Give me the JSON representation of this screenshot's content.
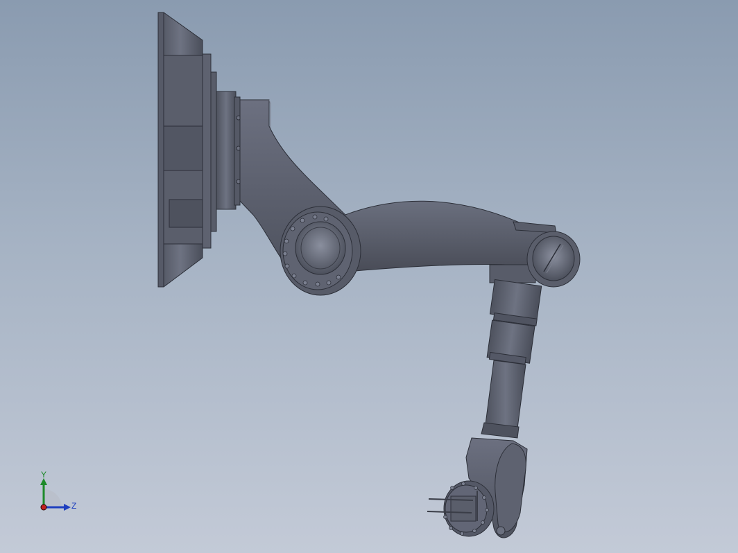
{
  "viewport": {
    "background_top": "#8a9bb0",
    "background_bottom": "#c3cad7"
  },
  "model": {
    "part_color": "#5c606e",
    "edge_color": "#2c2f38",
    "highlight_color": "#7a7f8d"
  },
  "triad": {
    "x_label": "",
    "y_label": "Y",
    "z_label": "Z",
    "y_color": "#1e8a2a",
    "z_color": "#1f3fbf",
    "x_color": "#c02020"
  }
}
